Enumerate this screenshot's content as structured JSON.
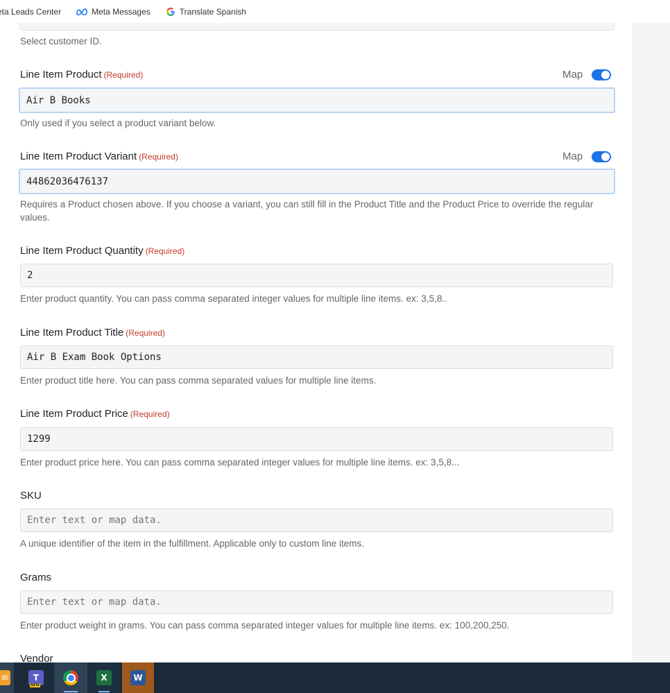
{
  "bookmarks": [
    {
      "label": "eta Leads Center",
      "icon": "meta-leads-icon"
    },
    {
      "label": "Meta Messages",
      "icon": "meta-icon"
    },
    {
      "label": "Translate Spanish",
      "icon": "google-icon"
    }
  ],
  "top_help": "Select customer ID.",
  "map_label": "Map",
  "required_label": "(Required)",
  "fields": {
    "product": {
      "label": "Line Item Product",
      "value": "Air B Books",
      "help": "Only used if you select a product variant below."
    },
    "variant": {
      "label": "Line Item Product Variant",
      "value": "44862036476137",
      "help": "Requires a Product chosen above. If you choose a variant, you can still fill in the Product Title and the Product Price to override the regular values."
    },
    "quantity": {
      "label": "Line Item Product Quantity",
      "value": "2",
      "help": "Enter product quantity. You can pass comma separated integer values for multiple line items. ex: 3,5,8.."
    },
    "title": {
      "label": "Line Item Product Title",
      "value": "Air B Exam Book Options",
      "help": "Enter product title here. You can pass comma separated values for multiple line items."
    },
    "price": {
      "label": "Line Item Product Price",
      "value": "1299",
      "help": "Enter product price here. You can pass comma separated integer values for multiple line items. ex: 3,5,8..."
    },
    "sku": {
      "label": "SKU",
      "placeholder": "Enter text or map data.",
      "help": "A unique identifier of the item in the fulfillment. Applicable only to custom line items."
    },
    "grams": {
      "label": "Grams",
      "placeholder": "Enter text or map data.",
      "help": "Enter product weight in grams. You can pass comma separated integer values for multiple line items. ex: 100,200,250."
    },
    "vendor": {
      "label": "Vendor"
    }
  },
  "taskbar": [
    {
      "name": "outlook-taskbar-icon",
      "color": "#f0a030"
    },
    {
      "name": "teams-taskbar-icon",
      "label": "T",
      "badge": "NEW",
      "color": "#5b5fc7"
    },
    {
      "name": "chrome-taskbar-icon",
      "color": "#db4437"
    },
    {
      "name": "excel-taskbar-icon",
      "label": "X",
      "color": "#1d6f42"
    },
    {
      "name": "word-taskbar-icon",
      "label": "W",
      "color": "#2b579a"
    }
  ]
}
